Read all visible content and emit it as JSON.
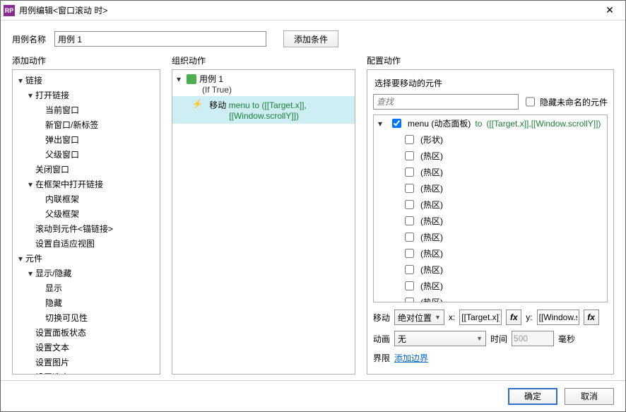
{
  "titlebar": {
    "app_badge": "RP",
    "title": "用例编辑<窗口滚动 时>"
  },
  "toprow": {
    "name_label": "用例名称",
    "name_value": "用例 1",
    "add_condition_label": "添加条件"
  },
  "headers": {
    "add_action": "添加动作",
    "organize_action": "组织动作",
    "configure_action": "配置动作"
  },
  "left_tree": [
    {
      "lvl": 0,
      "expand": "down",
      "label": "链接"
    },
    {
      "lvl": 1,
      "expand": "down",
      "label": "打开链接"
    },
    {
      "lvl": 2,
      "expand": "none",
      "label": "当前窗口"
    },
    {
      "lvl": 2,
      "expand": "none",
      "label": "新窗口/新标签"
    },
    {
      "lvl": 2,
      "expand": "none",
      "label": "弹出窗口"
    },
    {
      "lvl": 2,
      "expand": "none",
      "label": "父级窗口"
    },
    {
      "lvl": 1,
      "expand": "none",
      "label": "关闭窗口"
    },
    {
      "lvl": 1,
      "expand": "down",
      "label": "在框架中打开链接"
    },
    {
      "lvl": 2,
      "expand": "none",
      "label": "内联框架"
    },
    {
      "lvl": 2,
      "expand": "none",
      "label": "父级框架"
    },
    {
      "lvl": 1,
      "expand": "none",
      "label": "滚动到元件<锚链接>"
    },
    {
      "lvl": 1,
      "expand": "none",
      "label": "设置自适应视图"
    },
    {
      "lvl": 0,
      "expand": "down",
      "label": "元件"
    },
    {
      "lvl": 1,
      "expand": "down",
      "label": "显示/隐藏"
    },
    {
      "lvl": 2,
      "expand": "none",
      "label": "显示"
    },
    {
      "lvl": 2,
      "expand": "none",
      "label": "隐藏"
    },
    {
      "lvl": 2,
      "expand": "none",
      "label": "切换可见性"
    },
    {
      "lvl": 1,
      "expand": "none",
      "label": "设置面板状态"
    },
    {
      "lvl": 1,
      "expand": "none",
      "label": "设置文本"
    },
    {
      "lvl": 1,
      "expand": "none",
      "label": "设置图片"
    },
    {
      "lvl": 1,
      "expand": "right",
      "label": "设置选中"
    }
  ],
  "mid": {
    "case_label": "用例 1",
    "condition": "(If True)",
    "action_verb": "移动",
    "action_target": "menu",
    "action_to": "to",
    "action_expr1": "([[Target.x]],",
    "action_expr2": "[[Window.scrollY]])"
  },
  "right": {
    "select_label": "选择要移动的元件",
    "search_placeholder": "查找",
    "hide_unnamed_label": "隐藏未命名的元件",
    "top_item": {
      "name": "menu (动态面板)",
      "to": "to",
      "expr": "([[Target.x]],[[Window.scrollY]])"
    },
    "children": [
      "(形状)",
      "(热区)",
      "(热区)",
      "(热区)",
      "(热区)",
      "(热区)",
      "(热区)",
      "(热区)",
      "(热区)",
      "(热区)",
      "(热区)"
    ],
    "move_label": "移动",
    "move_mode": "绝对位置",
    "x_label": "x:",
    "x_value": "[[Target.x]]",
    "y_label": "y:",
    "y_value": "[[Window.scrollY]]",
    "fx_label": "fx",
    "anim_label": "动画",
    "anim_value": "无",
    "time_label": "时间",
    "time_value": "500",
    "time_unit": "毫秒",
    "bounds_label": "界限",
    "bounds_link": "添加边界"
  },
  "footer": {
    "ok": "确定",
    "cancel": "取消"
  }
}
